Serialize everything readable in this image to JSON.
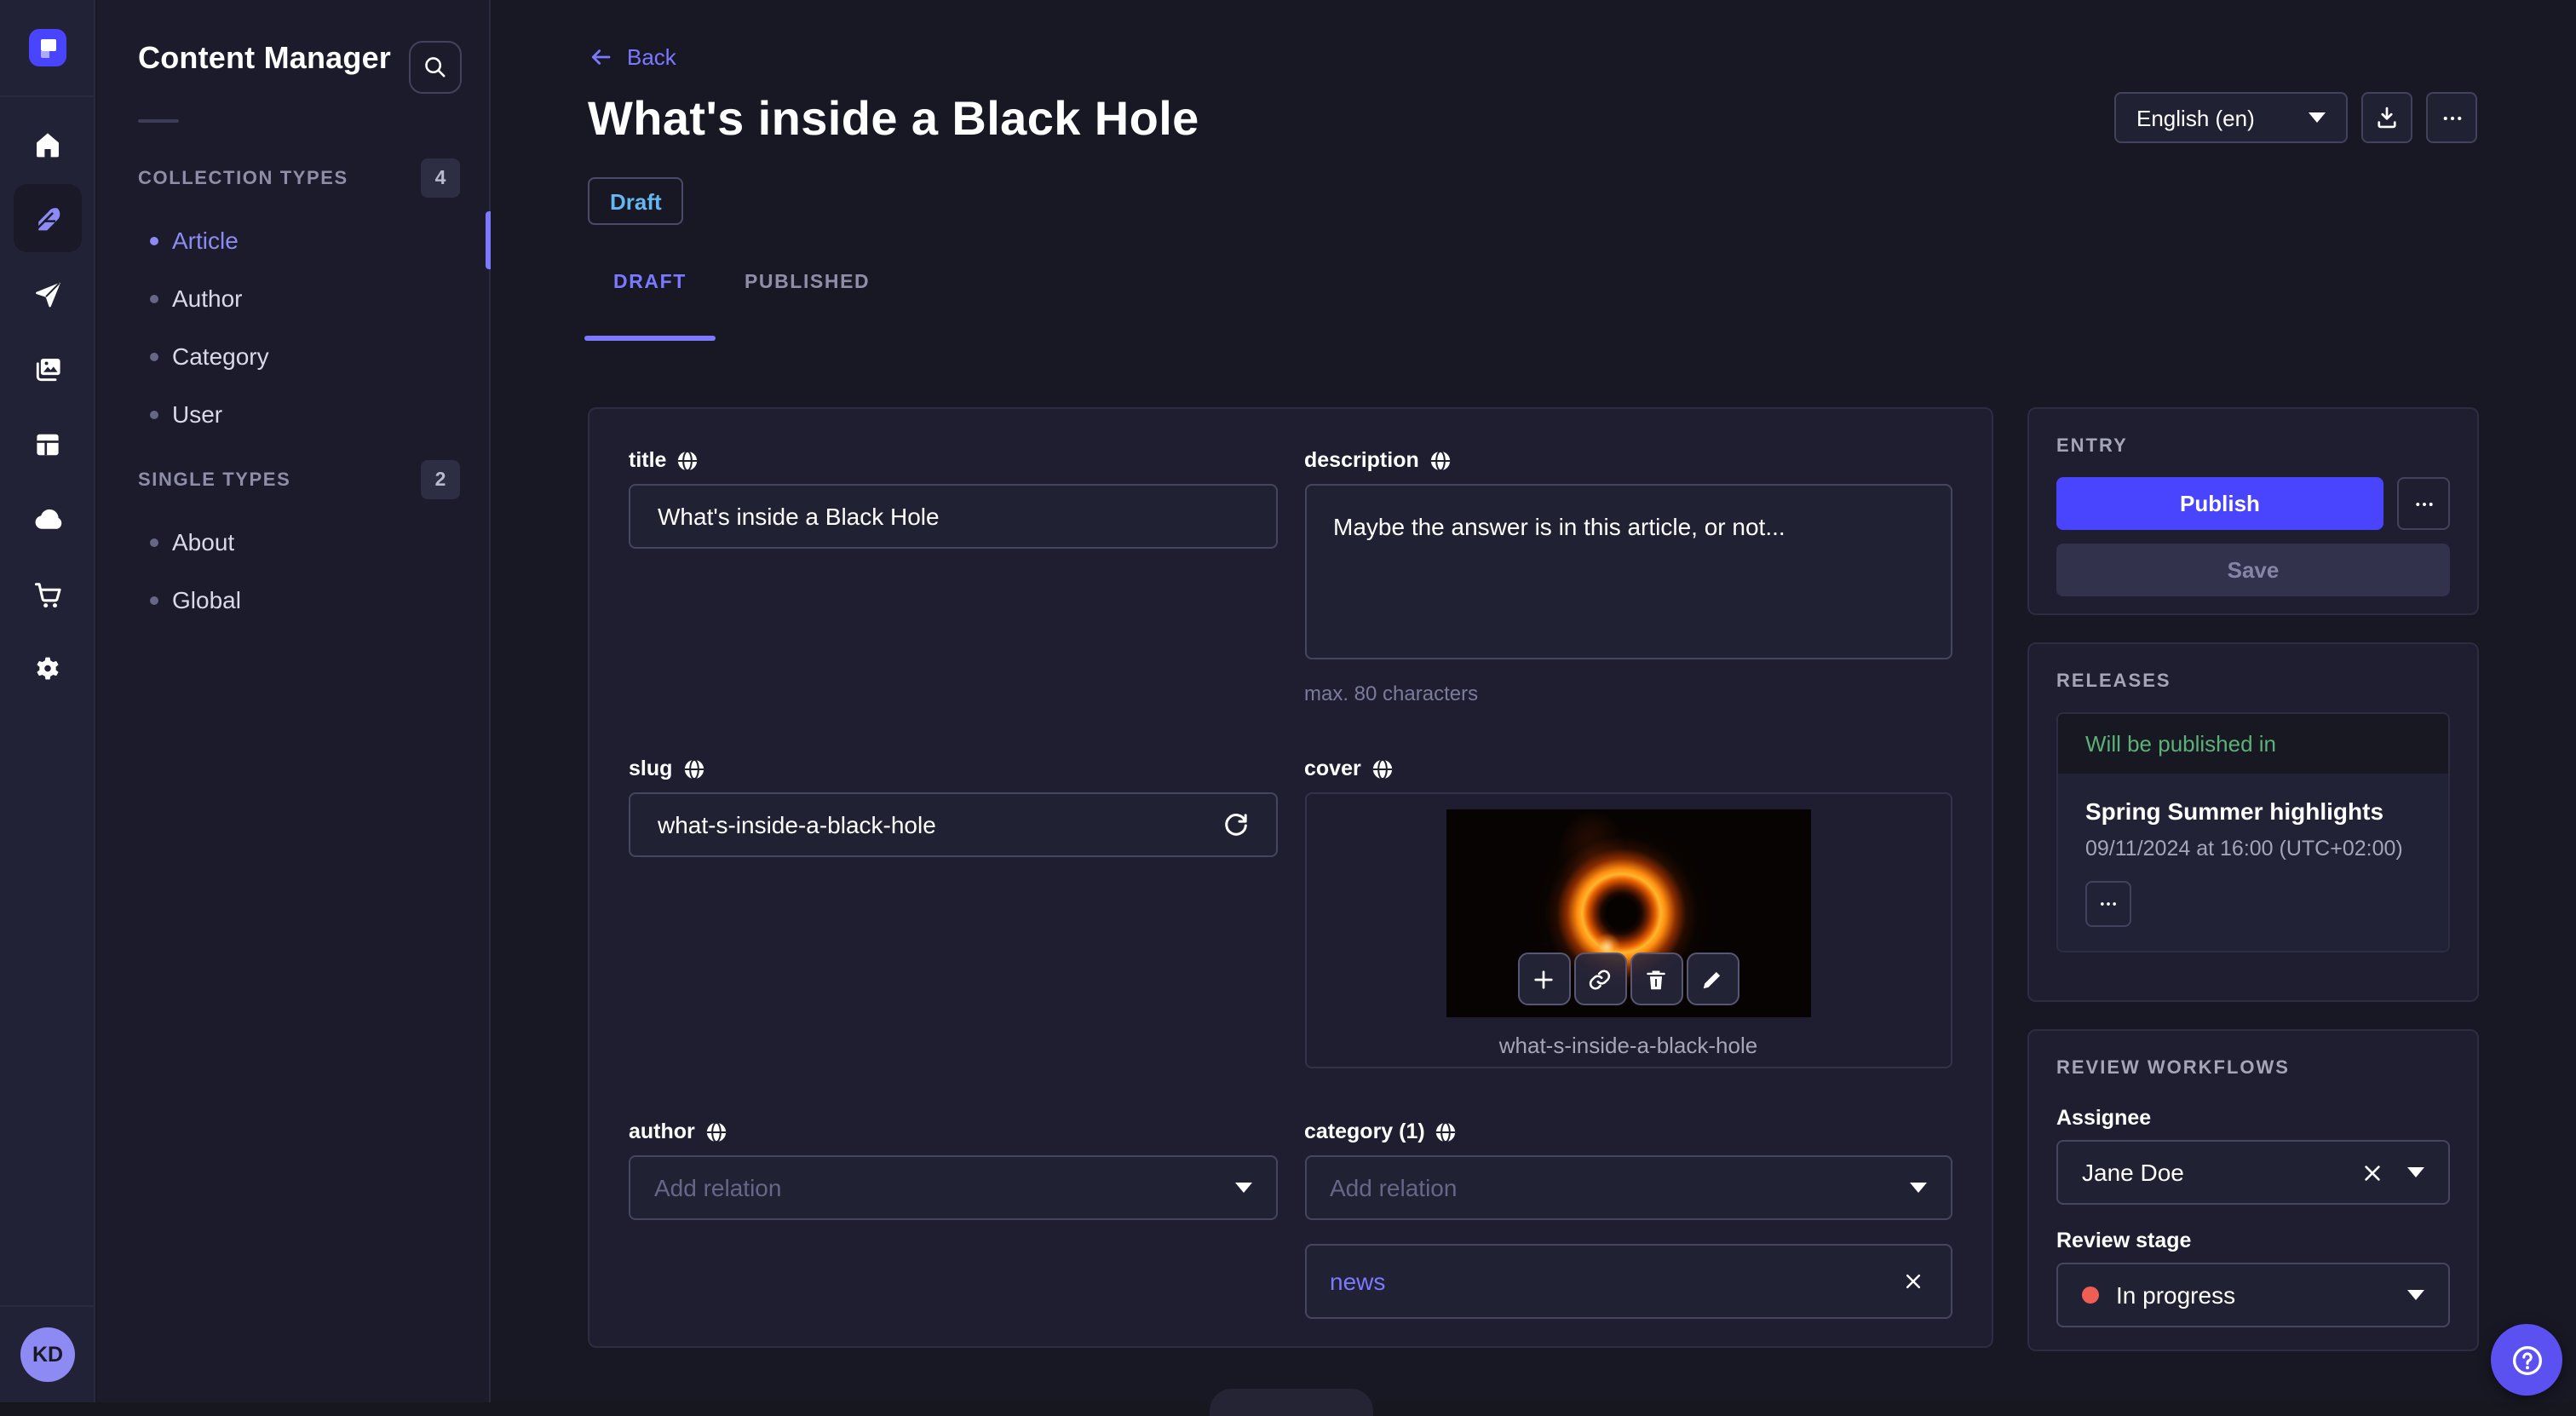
{
  "colors": {
    "accent": "#4945ff",
    "accent_light": "#7b79ff",
    "draft_blue": "#66b7f1",
    "success_green": "#5cb176",
    "danger_red": "#ee5e52",
    "avatar_purple": "#8e8af3"
  },
  "subnav": {
    "title": "Content Manager",
    "collection_types": {
      "label": "COLLECTION TYPES",
      "count": "4",
      "items": [
        {
          "label": "Article"
        },
        {
          "label": "Author"
        },
        {
          "label": "Category"
        },
        {
          "label": "User"
        }
      ]
    },
    "single_types": {
      "label": "SINGLE TYPES",
      "count": "2",
      "items": [
        {
          "label": "About"
        },
        {
          "label": "Global"
        }
      ]
    }
  },
  "header": {
    "back_label": "Back",
    "title": "What's inside a Black Hole",
    "status_badge": "Draft",
    "locale_value": "English (en)",
    "tabs": [
      {
        "label": "DRAFT"
      },
      {
        "label": "PUBLISHED"
      }
    ]
  },
  "form": {
    "title": {
      "label": "title",
      "value": "What's inside a Black Hole"
    },
    "description": {
      "label": "description",
      "value": "Maybe the answer is in this article, or not...",
      "hint": "max. 80 characters"
    },
    "slug": {
      "label": "slug",
      "value": "what-s-inside-a-black-hole"
    },
    "cover": {
      "label": "cover",
      "filename": "what-s-inside-a-black-hole"
    },
    "author": {
      "label": "author",
      "placeholder": "Add relation"
    },
    "category": {
      "label": "category (1)",
      "placeholder": "Add relation",
      "relations": [
        {
          "label": "news"
        }
      ]
    }
  },
  "entry_panel": {
    "label": "ENTRY",
    "publish_label": "Publish",
    "save_label": "Save"
  },
  "releases_panel": {
    "label": "RELEASES",
    "status": "Will be published in",
    "release_title": "Spring Summer highlights",
    "release_date": "09/11/2024 at 16:00 (UTC+02:00)"
  },
  "workflow_panel": {
    "label": "REVIEW WORKFLOWS",
    "assignee_label": "Assignee",
    "assignee_value": "Jane Doe",
    "stage_label": "Review stage",
    "stage_value": "In progress"
  },
  "user": {
    "initials": "KD"
  }
}
